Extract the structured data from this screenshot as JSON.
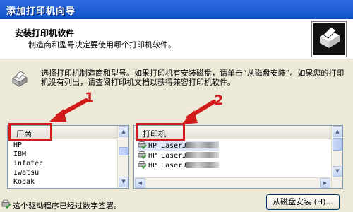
{
  "window": {
    "title": "添加打印机向导"
  },
  "header": {
    "heading": "安装打印机软件",
    "subheading": "制造商和型号决定要使用哪个打印机软件。"
  },
  "instructions": "选择打印机制造商和型号。如果打印机有安装磁盘，请单击“从磁盘安装”。如果您的打印机没有列出，请查阅打印机文档以获得兼容打印机软件。",
  "manufacturers": {
    "header": "厂商",
    "items": [
      "HP",
      "IBM",
      "infotec",
      "Iwatsu",
      "Kodak"
    ]
  },
  "printers": {
    "header": "打印机",
    "items": [
      "HP LaserJ",
      "HP LaserJ",
      "HP LaserJ"
    ]
  },
  "annotations": {
    "label_1": "1",
    "label_2": "2"
  },
  "signature_status": "这个驱动程序已经过数字签署。",
  "buttons": {
    "have_disk": "从磁盘安装 (H)..."
  },
  "colors": {
    "title_bar": "#2463d6",
    "annotation_red": "#d21c1c",
    "list_border": "#7f9db9"
  },
  "icons": [
    "printer-wizard-icon",
    "printer-icon",
    "printer-driver-icon",
    "signed-driver-icon"
  ]
}
